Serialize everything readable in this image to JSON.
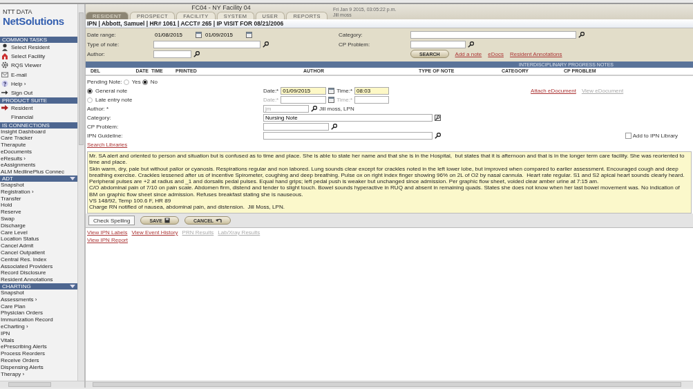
{
  "sidebar": {
    "logo_top": "NTT DATA",
    "logo_main": "NetSolutions",
    "sections": [
      {
        "title": "COMMON TASKS",
        "collapsible": false,
        "items": [
          {
            "label": "Select Resident",
            "kind": "person"
          },
          {
            "label": "Select Facility",
            "kind": "house"
          },
          {
            "label": "RQS Viewer",
            "kind": "gear"
          },
          {
            "label": "E-mail",
            "kind": "mail"
          },
          {
            "label": "Help ›",
            "kind": "help"
          },
          {
            "label": "Sign Out",
            "kind": "signout"
          }
        ]
      },
      {
        "title": "PRODUCT SUITE",
        "collapsible": false,
        "items": [
          {
            "label": "Resident",
            "kind": "arrow"
          },
          {
            "label": "Financial",
            "kind": "indented"
          }
        ]
      },
      {
        "title": "IS CONNECTIONS",
        "collapsible": false,
        "items": [
          {
            "label": "Insight Dashboard"
          },
          {
            "label": "Care Tracker"
          },
          {
            "label": "Therapute"
          },
          {
            "label": "eDocuments"
          },
          {
            "label": "eResults ›"
          },
          {
            "label": "eAssignments"
          },
          {
            "label": "ALM MedlinePlus Connec"
          }
        ]
      },
      {
        "title": "ADT",
        "collapsible": true,
        "items": [
          {
            "label": "Snapshot"
          },
          {
            "label": "Registration ›"
          },
          {
            "label": "Transfer"
          },
          {
            "label": "Hold"
          },
          {
            "label": "Reserve"
          },
          {
            "label": "Swap"
          },
          {
            "label": "Discharge"
          },
          {
            "label": "Care Level"
          },
          {
            "label": "Location Status"
          },
          {
            "label": "Cancel Admit"
          },
          {
            "label": "Cancel Outpatient"
          },
          {
            "label": "Central Res. Index"
          },
          {
            "label": "Associated Providers"
          },
          {
            "label": "Record Disclosure"
          },
          {
            "label": "Resident Annotations"
          }
        ]
      },
      {
        "title": "CHARTING",
        "collapsible": true,
        "items": [
          {
            "label": "Snapshot"
          },
          {
            "label": "Assessments ›"
          },
          {
            "label": "Care Plan"
          },
          {
            "label": "Physician Orders"
          },
          {
            "label": "Immunization Record"
          },
          {
            "label": "eCharting ›"
          },
          {
            "label": "IPN"
          },
          {
            "label": "Vitals"
          },
          {
            "label": "ePrescribing Alerts"
          },
          {
            "label": "Process Reorders"
          },
          {
            "label": "Receive Orders"
          },
          {
            "label": "Dispensing Alerts"
          },
          {
            "label": "Therapy ›"
          }
        ]
      }
    ]
  },
  "header": {
    "facility": "FC04  -  NY Facility 04",
    "datetime": "Fri Jan 9 2015, 03:05:22 p.m.",
    "user": "Jill moss",
    "tabs": [
      {
        "label": "RESIDENT",
        "selected": true
      },
      {
        "label": "PROSPECT",
        "selected": false
      },
      {
        "label": "FACILITY",
        "selected": false
      },
      {
        "label": "SYSTEM",
        "selected": false
      },
      {
        "label": "USER",
        "selected": false
      },
      {
        "label": "REPORTS",
        "selected": false
      }
    ]
  },
  "breadcrumb": "IPN | Abbott, Samuel  | HR# 1061 | ACCT# 265 | IP VISIT FOR 08/21/2006",
  "filter": {
    "date_range_label": "Date range:",
    "date_from": "01/08/2015",
    "date_to": "01/09/2015",
    "type_label": "Type of note:",
    "author_label": "Author:",
    "category_label": "Category:",
    "cp_label": "CP Problem:",
    "search_button": "SEARCH",
    "links": [
      "Add a note",
      "eDocs",
      "Resident Annotations"
    ]
  },
  "notes_title": "INTERDISCIPLINARY PROGRESS NOTES",
  "columns": [
    "DEL",
    "DATE",
    "TIME",
    "PRINTED",
    "AUTHOR",
    "TYPE OF NOTE",
    "CATEGORY",
    "CP PROBLEM"
  ],
  "form": {
    "pending_label": "Pending Note:",
    "pending_options": [
      {
        "label": "Yes",
        "selected": false
      },
      {
        "label": "No",
        "selected": true
      }
    ],
    "note_types": [
      {
        "label": "General note",
        "selected": true
      },
      {
        "label": "Late entry note",
        "selected": false
      }
    ],
    "general": {
      "date_label": "Date:*",
      "date": "01/09/2015",
      "time_label": "Time:*",
      "time": "08:03",
      "disabled": false
    },
    "late": {
      "date_label": "Date:*",
      "time_label": "Time:*",
      "disabled": true
    },
    "doc_links": [
      {
        "label": "Attach eDocument",
        "disabled": false
      },
      {
        "label": "View eDocument",
        "disabled": true
      }
    ],
    "author_label": "Author: *",
    "author_value": "jm",
    "author_name": "Jill moss, LPN",
    "category_label": "Category:",
    "category_value": "Nursing Note",
    "cp_label": "CP Problem:",
    "guideline_label": "IPN Guideline:",
    "library": {
      "label": "Add to IPN Library",
      "checked": false
    },
    "search_libraries": "Search Libraries"
  },
  "note_text": [
    "Mr. SA alert and oriented to person and situation but is confused as to time and place. She is able to state her name and that she is in the Hospital,  but states that it is afternoon and that is in the longer term care facility. She was reoriented to time and place.",
    "Skin warm, dry, pale but without pallor or cyanosis. Respirations regular and non labored. Lung sounds clear except for crackles noted in the left lower lobe, but improved when compared to earlier assessment. Encouraged cough and deep breathing exercise. Crackles lessened after us of incentive Spirometer, coughing and deep breathing. Pulse ox on right index finger showing 96% on 2L of O2 by nasal cannula.  Heart rate regular. S1 and S2 apical heart sounds clearly heard.",
    "Peripheral pulses are +2 at radius and _1 and dorsalis pedal pulses. Equal hand grips; left pedal push is weaker but unchanged since admission. Per graphic flow sheet, voided clear amber urine at 7:15 am.",
    "C/O abdominal pain of 7/10 on pain scale. Abdomen firm, distend and tender to slight touch. Bowel sounds hyperactive in RUQ and absent in remaining quads. States she does not know when her last bowel movement was. No indication of BM on graphic flow sheet since admission. Refuses breakfast stating she is nauseous.",
    "VS 148/92, Temp 100.6 F, HR 89",
    "Charge RN notified of nausea, abdominal pain, and distension.  Jill Moss, LPN."
  ],
  "buttons": [
    {
      "label": "Check Spelling",
      "kind": "plain"
    },
    {
      "label": "SAVE",
      "kind": "save"
    },
    {
      "label": "CANCEL",
      "kind": "cancel"
    }
  ],
  "bottom_links": [
    {
      "label": "View IPN Labels",
      "disabled": false
    },
    {
      "label": "View Event History",
      "disabled": false
    },
    {
      "label": "PRN Results",
      "disabled": true
    },
    {
      "label": "Lab/Xray Results",
      "disabled": true
    }
  ],
  "report_link": "View IPN Report"
}
